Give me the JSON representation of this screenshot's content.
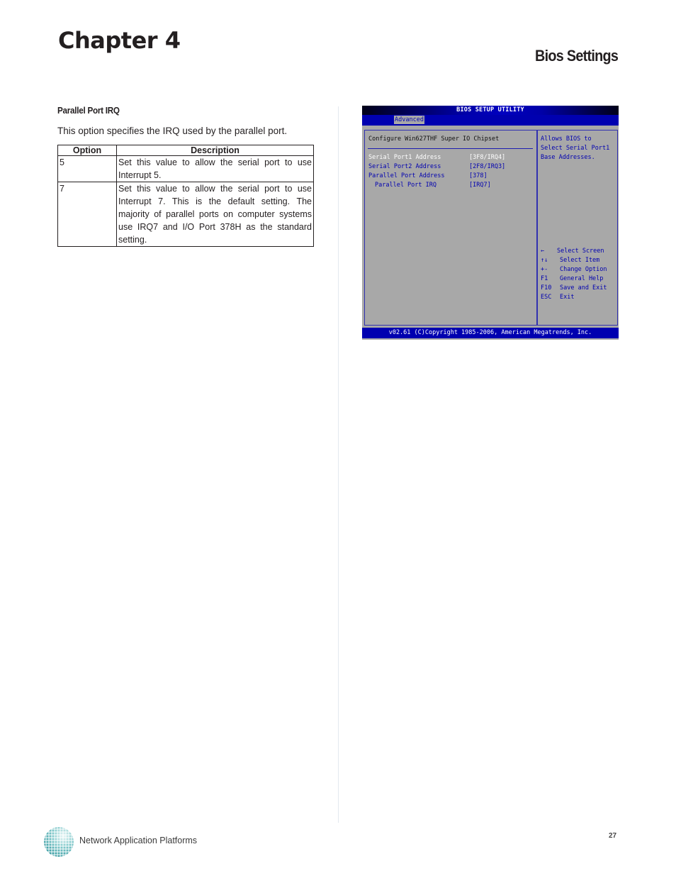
{
  "header": {
    "chapter_title": "Chapter 4",
    "section_title": "Bios Settings"
  },
  "content": {
    "subheading": "Parallel Port IRQ",
    "intro": "This option specifies the IRQ used by the parallel port.",
    "table": {
      "headers": [
        "Option",
        "Description"
      ],
      "rows": [
        {
          "option": "5",
          "description": "Set this value to allow the serial port to use Interrupt 5."
        },
        {
          "option": "7",
          "description": "Set this value to allow the serial port to use Interrupt 7. This is the default setting. The majority of parallel ports on computer systems use IRQ7 and I/O Port 378H as the standard setting."
        }
      ]
    }
  },
  "bios": {
    "title": "BIOS SETUP UTILITY",
    "active_tab": "Advanced",
    "heading": "Configure Win627THF Super IO Chipset",
    "settings": [
      {
        "label": "Serial Port1 Address",
        "value": "[3F8/IRQ4]",
        "selected": true,
        "indent": false
      },
      {
        "label": "Serial Port2 Address",
        "value": "[2F8/IRQ3]",
        "selected": false,
        "indent": false
      },
      {
        "label": "Parallel Port Address",
        "value": "[378]",
        "selected": false,
        "indent": false
      },
      {
        "label": "Parallel Port IRQ",
        "value": "[IRQ7]",
        "selected": false,
        "indent": true
      }
    ],
    "help_text": "Allows BIOS to Select Serial Port1 Base Addresses.",
    "keys": [
      {
        "key": "←",
        "action": "Select Screen"
      },
      {
        "key": "↑↓",
        "action": "Select Item"
      },
      {
        "key": "+-",
        "action": "Change Option"
      },
      {
        "key": "F1",
        "action": "General Help"
      },
      {
        "key": "F10",
        "action": "Save and Exit"
      },
      {
        "key": "ESC",
        "action": "Exit"
      }
    ],
    "footer": "v02.61 (C)Copyright 1985-2006, American Megatrends, Inc.",
    "colors": {
      "background": "#a8a8a8",
      "accent": "#0000b0",
      "title_text": "#ffffff"
    }
  },
  "footer": {
    "brand_text": "Network Application Platforms",
    "page_number": "27",
    "logo_icon": "globe-dots-icon"
  }
}
